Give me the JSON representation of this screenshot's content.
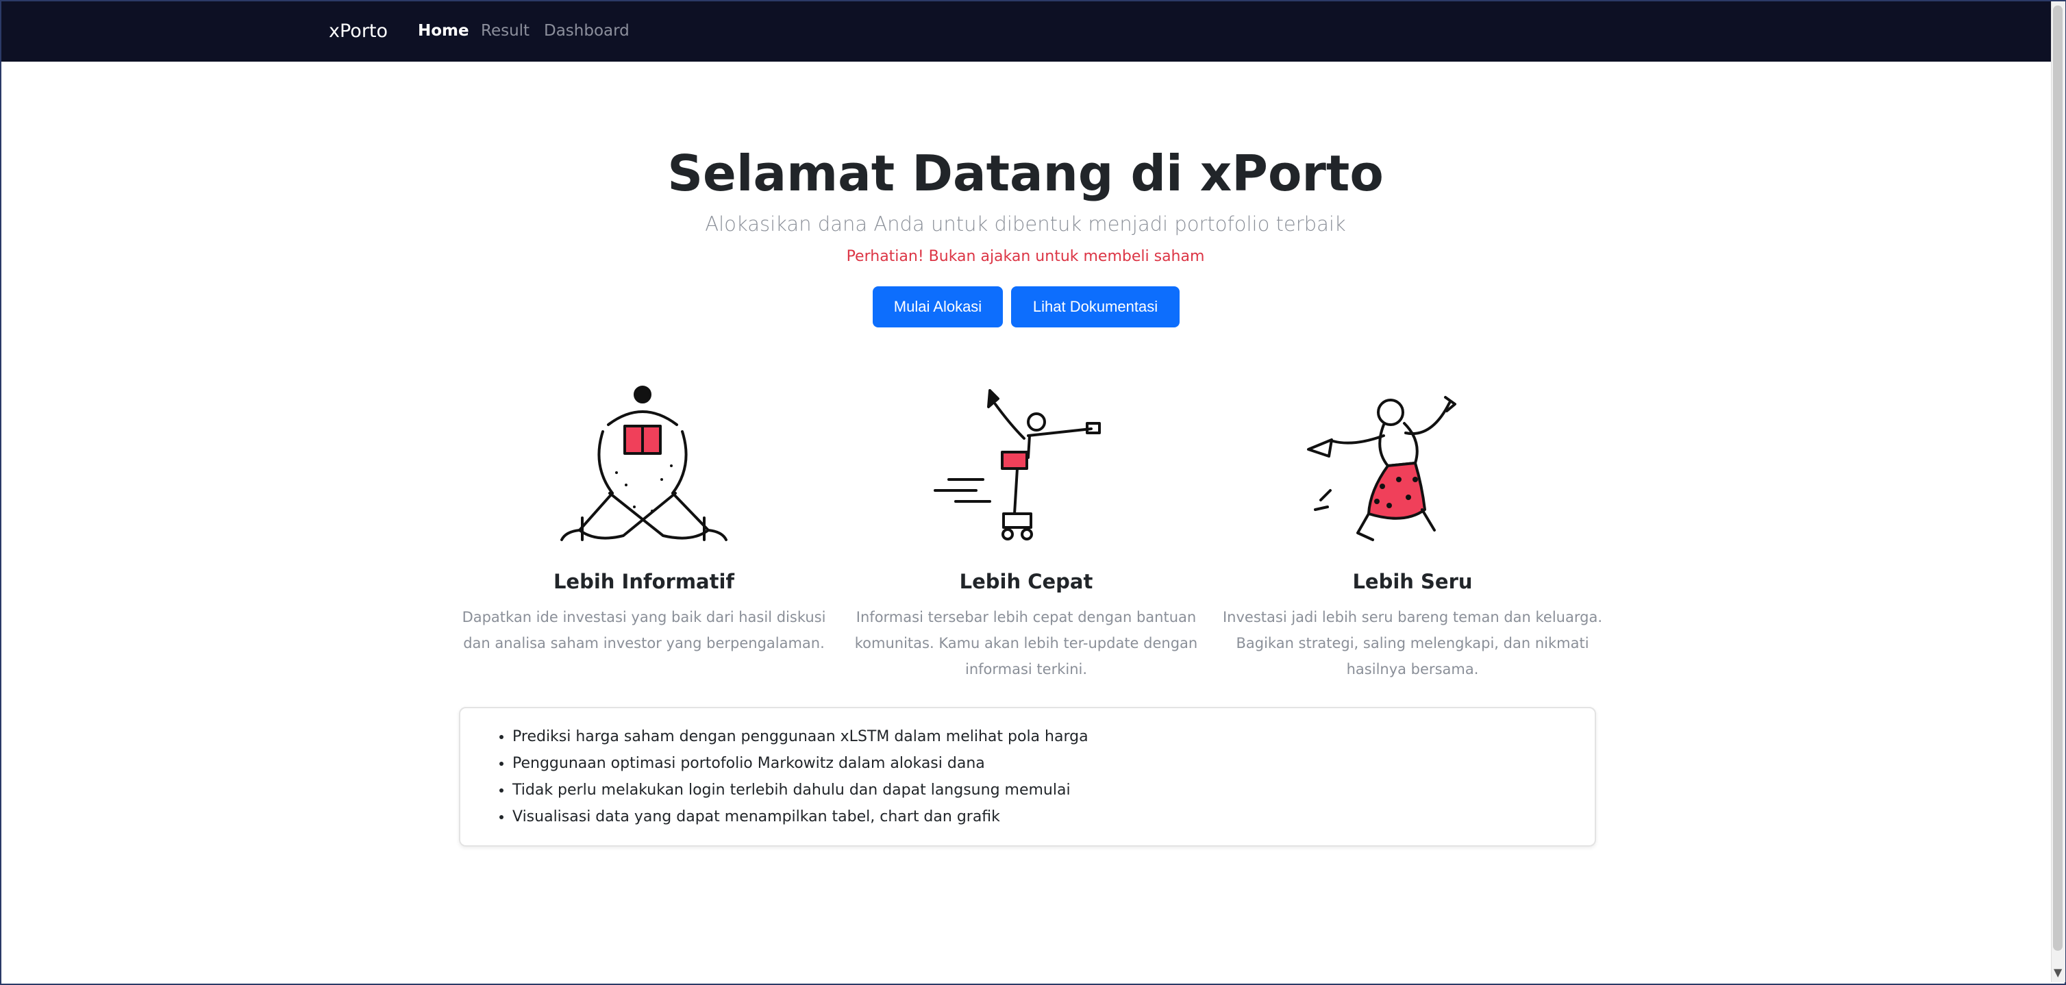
{
  "nav": {
    "brand": "xPorto",
    "items": [
      "Home",
      "Result",
      "Dashboard"
    ]
  },
  "hero": {
    "title": "Selamat Datang di xPorto",
    "subtitle": "Alokasikan dana Anda untuk dibentuk menjadi portofolio terbaik",
    "warning": "Perhatian! Bukan ajakan untuk membeli saham",
    "buttons": [
      "Mulai Alokasi",
      "Lihat Dokumentasi"
    ]
  },
  "features": [
    {
      "title": "Lebih Informatif",
      "description": "Dapatkan ide investasi yang baik dari hasil diskusi dan analisa saham investor yang berpengalaman."
    },
    {
      "title": "Lebih Cepat",
      "description": "Informasi tersebar lebih cepat dengan bantuan komunitas. Kamu akan lebih ter-update dengan informasi terkini."
    },
    {
      "title": "Lebih Seru",
      "description": "Investasi jadi lebih seru bareng teman dan keluarga. Bagikan strategi, saling melengkapi, dan nikmati hasilnya bersama."
    }
  ],
  "highlights": [
    "Prediksi harga saham dengan penggunaan xLSTM dalam melihat pola harga",
    "Penggunaan optimasi portofolio Markowitz dalam alokasi dana",
    "Tidak perlu melakukan login terlebih dahulu dan dapat langsung memulai",
    "Visualisasi data yang dapat menampilkan tabel, chart dan grafik"
  ],
  "colors": {
    "navbar": "#0d1024",
    "primary": "#0d6efd",
    "warning": "#dc3545",
    "accent": "#f0405a"
  }
}
